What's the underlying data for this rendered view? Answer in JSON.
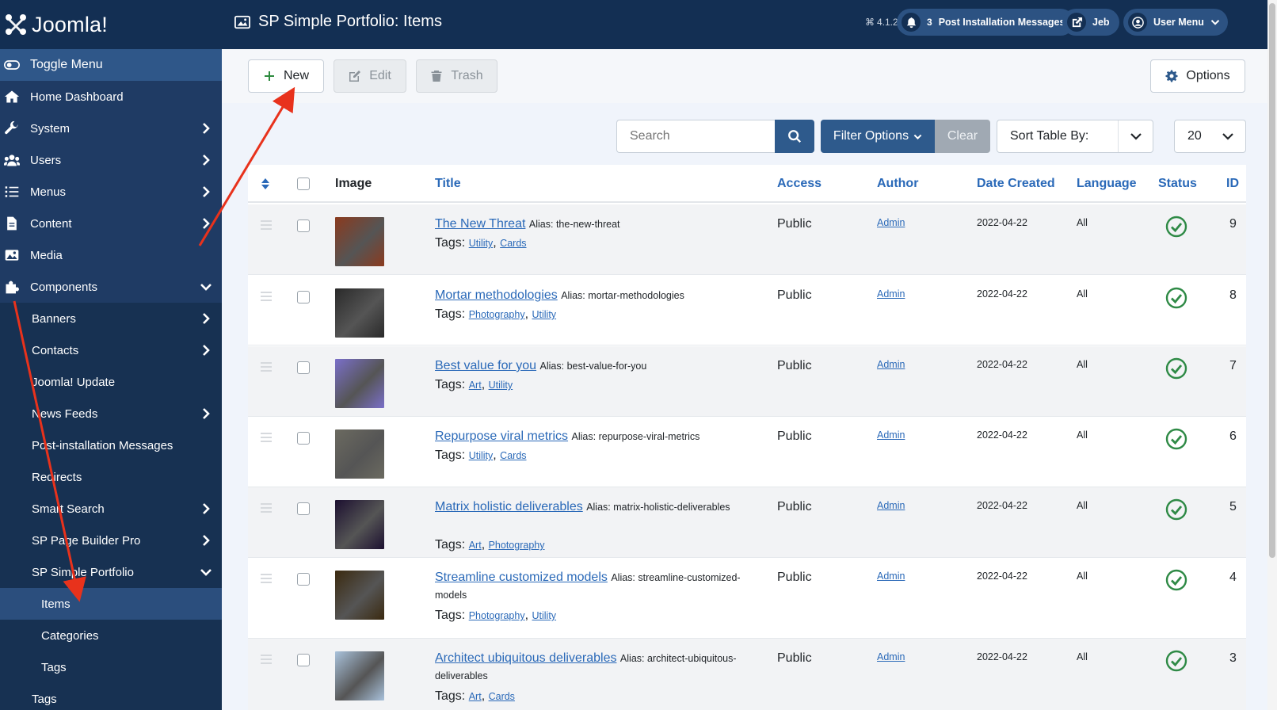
{
  "brand": {
    "name": "Joomla!"
  },
  "header": {
    "title": "SP Simple Portfolio: Items",
    "version": "4.1.2",
    "post_install": {
      "count": "3",
      "label": "Post Installation Messages"
    },
    "site_label": "Jeb",
    "user_menu": "User Menu"
  },
  "sidebar": {
    "toggle": "Toggle Menu",
    "items": [
      {
        "label": "Home Dashboard"
      },
      {
        "label": "System"
      },
      {
        "label": "Users"
      },
      {
        "label": "Menus"
      },
      {
        "label": "Content"
      },
      {
        "label": "Media"
      },
      {
        "label": "Components"
      }
    ],
    "components": [
      {
        "label": "Banners"
      },
      {
        "label": "Contacts"
      },
      {
        "label": "Joomla! Update"
      },
      {
        "label": "News Feeds"
      },
      {
        "label": "Post-installation Messages"
      },
      {
        "label": "Redirects"
      },
      {
        "label": "Smart Search"
      },
      {
        "label": "SP Page Builder Pro"
      },
      {
        "label": "SP Simple Portfolio"
      }
    ],
    "portfolio": [
      {
        "label": "Items"
      },
      {
        "label": "Categories"
      },
      {
        "label": "Tags"
      }
    ],
    "bottom": {
      "label": "Tags"
    }
  },
  "toolbar": {
    "new": "New",
    "edit": "Edit",
    "trash": "Trash",
    "options": "Options"
  },
  "filters": {
    "search_placeholder": "Search",
    "filter_options": "Filter Options",
    "clear": "Clear",
    "sort_label": "Sort Table By:",
    "limit": "20"
  },
  "columns": {
    "image": "Image",
    "title": "Title",
    "access": "Access",
    "author": "Author",
    "date": "Date Created",
    "language": "Language",
    "status": "Status",
    "id": "ID"
  },
  "labels": {
    "alias": "Alias:",
    "tags": "Tags:"
  },
  "rows": [
    {
      "title": "The New Threat",
      "alias": "the-new-threat",
      "tags": [
        "Utility",
        "Cards"
      ],
      "access": "Public",
      "author": "Admin",
      "date": "2022-04-22",
      "language": "All",
      "id": "9",
      "thumb": "#8b3a1e"
    },
    {
      "title": "Mortar methodologies",
      "alias": "mortar-methodologies",
      "tags": [
        "Photography",
        "Utility"
      ],
      "access": "Public",
      "author": "Admin",
      "date": "2022-04-22",
      "language": "All",
      "id": "8",
      "thumb": "#2a2a2a"
    },
    {
      "title": "Best value for you",
      "alias": "best-value-for-you",
      "tags": [
        "Art",
        "Utility"
      ],
      "access": "Public",
      "author": "Admin",
      "date": "2022-04-22",
      "language": "All",
      "id": "7",
      "thumb": "#7a6fc9"
    },
    {
      "title": "Repurpose viral metrics",
      "alias": "repurpose-viral-metrics",
      "tags": [
        "Utility",
        "Cards"
      ],
      "access": "Public",
      "author": "Admin",
      "date": "2022-04-22",
      "language": "All",
      "id": "6",
      "thumb": "#6b6a60"
    },
    {
      "title": "Matrix holistic deliverables",
      "alias": "matrix-holistic-deliverables",
      "tags": [
        "Art",
        "Photography"
      ],
      "access": "Public",
      "author": "Admin",
      "date": "2022-04-22",
      "language": "All",
      "id": "5",
      "thumb": "#1c1030"
    },
    {
      "title": "Streamline customized models",
      "alias": "streamline-customized-models",
      "tags": [
        "Photography",
        "Utility"
      ],
      "access": "Public",
      "author": "Admin",
      "date": "2022-04-22",
      "language": "All",
      "id": "4",
      "thumb": "#3b2a10"
    },
    {
      "title": "Architect ubiquitous deliverables",
      "alias": "architect-ubiquitous-deliverables",
      "tags": [
        "Art",
        "Cards"
      ],
      "access": "Public",
      "author": "Admin",
      "date": "2022-04-22",
      "language": "All",
      "id": "3",
      "thumb": "#a9c2dc"
    }
  ],
  "colors": {
    "sidebar": "#1f3b64",
    "header": "#132f53",
    "accent": "#2a69b8",
    "status_ok": "#2f8a46",
    "annotation": "#e8321c"
  }
}
